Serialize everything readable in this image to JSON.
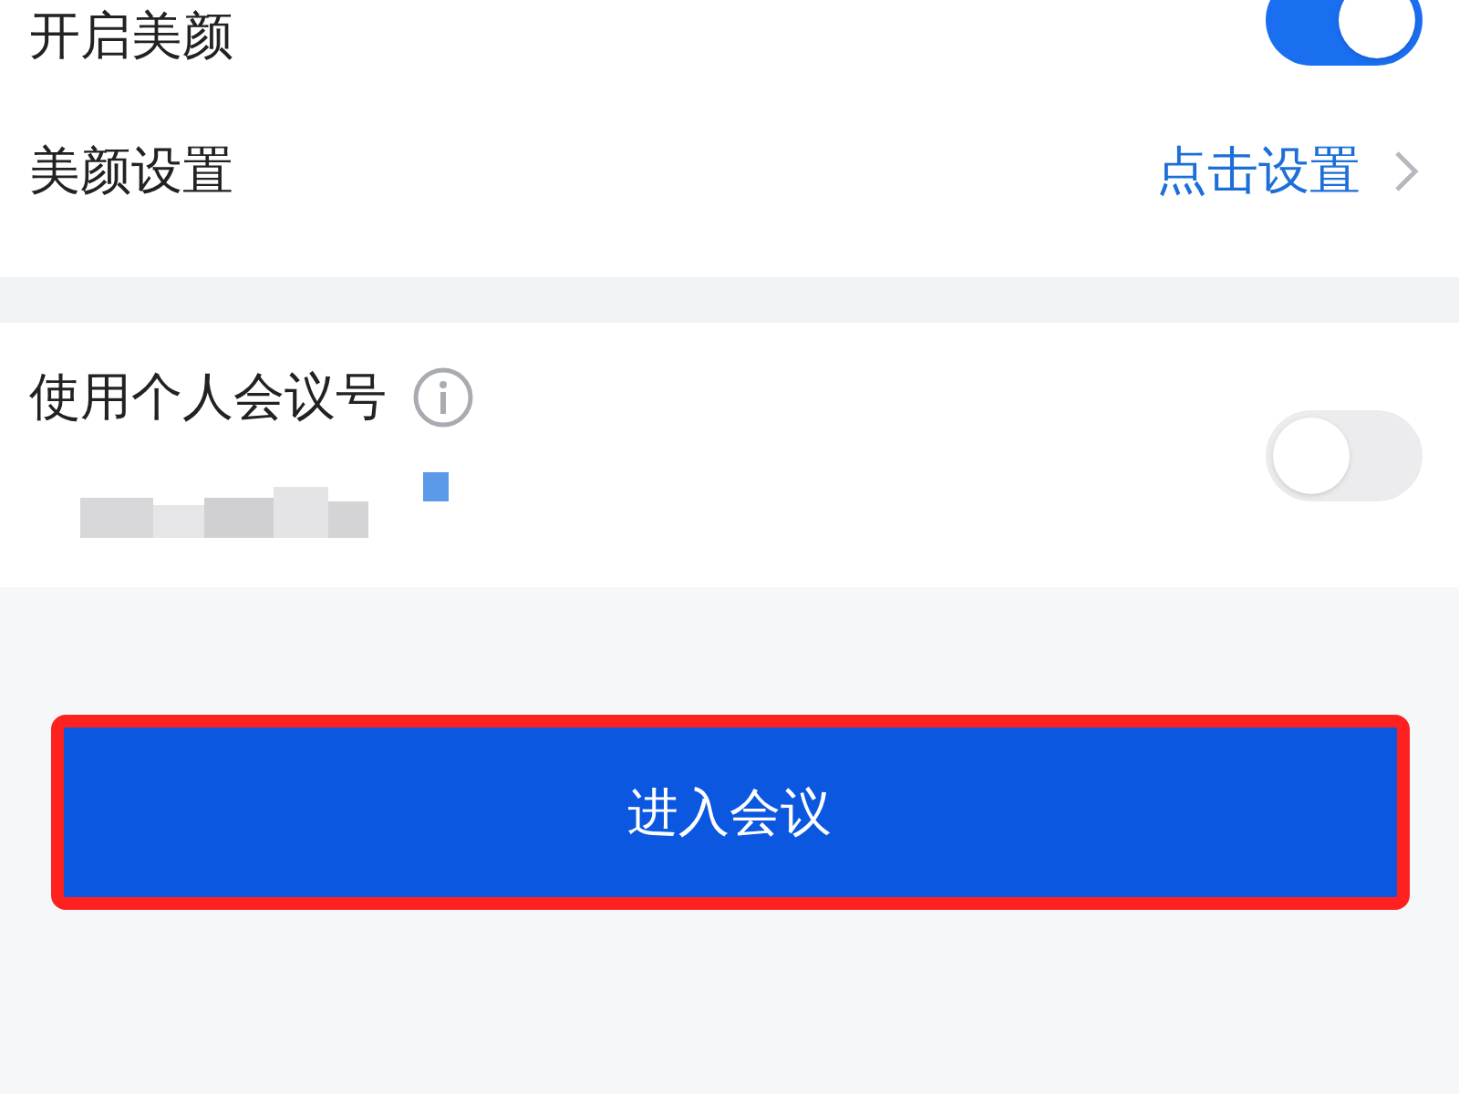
{
  "settings": [
    {
      "kind": "toggle",
      "label": "开启美颜",
      "on": true
    },
    {
      "kind": "link",
      "label": "美颜设置",
      "value": "点击设置"
    }
  ],
  "personal_meeting": {
    "label": "使用个人会议号",
    "on": false
  },
  "enter_button": {
    "label": "进入会议",
    "highlighted": true
  }
}
